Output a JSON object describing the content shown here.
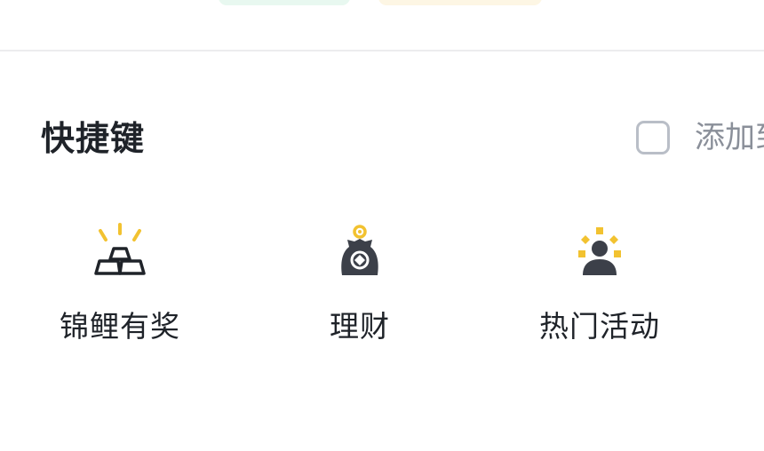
{
  "colors": {
    "accent_yellow": "#f2c230",
    "icon_dark": "#3c4049",
    "pill_green": "#e8f8f0",
    "pill_yellow": "#fdf6e4"
  },
  "shortcuts_section": {
    "title": "快捷键",
    "add_label": "添加到",
    "add_checked": false
  },
  "shortcuts": [
    {
      "label": "锦鲤有奖",
      "icon": "gold-bars-icon"
    },
    {
      "label": "理财",
      "icon": "money-bag-icon"
    },
    {
      "label": "热门活动",
      "icon": "person-sparkle-icon"
    }
  ]
}
